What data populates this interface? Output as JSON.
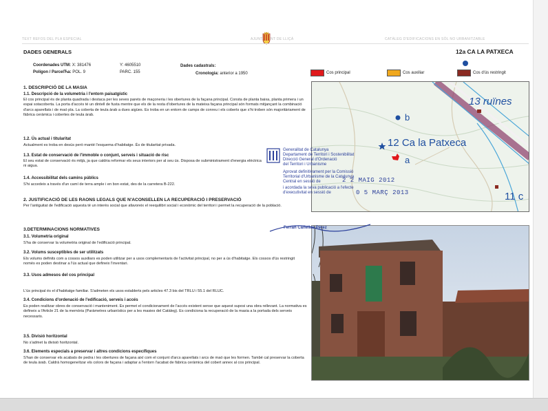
{
  "header": {
    "left": "TEXT REFOS DEL PLA ESPECIAL",
    "mid": "AJUNTAMENT DE LLIÇÀ",
    "right": "CATÀLEG D'EDIFICACIONS EN SÒL NO URBANITZABLE"
  },
  "title": "DADES GENERALS",
  "ref": "12a CA LA PATXECA",
  "coords": {
    "utm_label": "Coordenades UTM:",
    "x": "X: 381476",
    "y": "Y: 4605510",
    "pol_label": "Polígon / ParcelЋa:",
    "pol": "POL. 9",
    "parc": "PARC. 155",
    "cad_label": "Dades cadastrals:",
    "cron_label": "Cronologia:",
    "cron": "anterior a 1950"
  },
  "legend": {
    "principal": "Cos principal",
    "auxiliar": "Cos auxiliar",
    "restringit": "Cos d'ús restringit",
    "colors": {
      "principal": "#e0191c",
      "auxiliar": "#f0a81e",
      "restringit": "#8a2a22"
    }
  },
  "sections": {
    "s1": "1. DESCRIPCIÓ DE LA MASIA",
    "s1_1": "1.1. Descripció de la volumetria i l'entorn paisatgístic",
    "s1_1_text": "El cos principal és de planta quadrada i destaca per les seves parets de maçoneria i les obertures de la façana principal. Consta de planta baixa, planta primera i un espai sotacoberta. La porta d'accés té un dintell de fusta mentre que els de la resta d'obertures de la mateixa façana principal són formats mitjançant la combinació d'arcs aparellats i de maó pla. La coberta de teula àrab a dues aigües. Es troba en un entorn de camps de conreu i els coberts que s'hi troben són majoritàriament de fàbrica ceràmica i cobertes de teula àrab.",
    "s1_2": "1.2. Ús actual i titularitat",
    "s1_2_text": "Actualment es troba en desús però manté l'esquema d'habitatge. És de titularitat privada.",
    "s1_3": "1.3. Estat de conservació de l'immoble o conjunt, serveis i situació de risc",
    "s1_3_text": "El seu estat de conservació és mitjà, ja que caldria reformar els seus interiors per al seu ús. Disposa de subministrament d'energia elèctrica ni aigua.",
    "s1_4": "1.4. Accessibilitat dels camins públics",
    "s1_4_text": "S'hi accedeix a través d'un camí de terra ample i en bon estat, des de la carretera B-222.",
    "s2": "2. JUSTIFICACIÓ DE LES RAONS LEGALS QUE N'ACONSELLEN LA RECUPERACIÓ I PRESERVACIÓ",
    "s2_text": "Per l'antiguitat de l'edificació aquesta té un interès social que afavoreix el reequilibri social i econòmic del territori i permet la recuperació de la població.",
    "s3": "3.DETERMINACIONS NORMATIVES",
    "s3_1": "3.1. Volumetria original",
    "s3_1_text": "S'ha de conservar la volumetria original de l'edificació principal.",
    "s3_2": "3.2. Volums susceptibles de ser utilitzats",
    "s3_2_text": "Els volums definits com a cossos auxiliars es poden utilitzar per a usos complementaris de l'activitat principal, no per a ús d'habitatge. Els cossos d'ús restringit només es poden destinar a l'ús actual que defineix l'inventari.",
    "s3_3": "3.3. Usos admesos del cos principal",
    "s3_3_text": "L'ús principal és el d'habitatge familiar. S'admeten els usos establerts pels articles 47.3 bis del TRLU i 55.1 del RLUC.",
    "s3_4": "3.4. Condicions d'ordenació de l'edificació, serveis i accés",
    "s3_4_text": "Es poden realitzar obres de conservació i manteniment. Es permet el condicionament de l'accés existent sense que aquest suposi una obra rellevant. La normativa es defineix a l'Article 21 de la memòria (Paràmetres urbanístics per a les masies del Catàleg). Es condiciona la recuperació de la masia a la portada dels serveis necessaris.",
    "s3_5": "3.5. Divisió horitzontal",
    "s3_5_text": "No s'admet la divisió horitzontal.",
    "s3_6": "3.6. Elements especials a preservar i altres condicions específiques",
    "s3_6_text": "S'han de conservar els acabats de pedra i les obertures de façana així com el conjunt d'arcs aparellats i arcs de maó que les formen. També cal preservar la coberta de teula àrab. Caldrà homogeneïtzar els colors de façana i adaptar a l'entorn l'acabat de fàbrica ceràmica del cobert annex al cos principal."
  },
  "map": {
    "label_b": "b",
    "label_a": "a",
    "name": "12 Ca la Patxeca",
    "label_13": "13 ruïnes",
    "label_11": "11 c"
  },
  "stamp": {
    "line1": "Generalitat de Catalunya",
    "line2": "Departament de Territori i Sostenibilitat",
    "line3": "Direcció General d'Ordenació",
    "line4": "del Territori i Urbanisme",
    "line5": "Aprovat definitivament per la Comissió",
    "line6": "Territorial d'Urbanisme de la Catalunya",
    "line7": "Central en sessió de",
    "date1": "2 2 MAIG 2012",
    "line8": "i acordada la seva publicació a l'efecte",
    "line9": "d'executivitat en sessió de",
    "date2": "0 5 MARÇ 2013",
    "sign": "Ferran Cañellas Pérez"
  }
}
